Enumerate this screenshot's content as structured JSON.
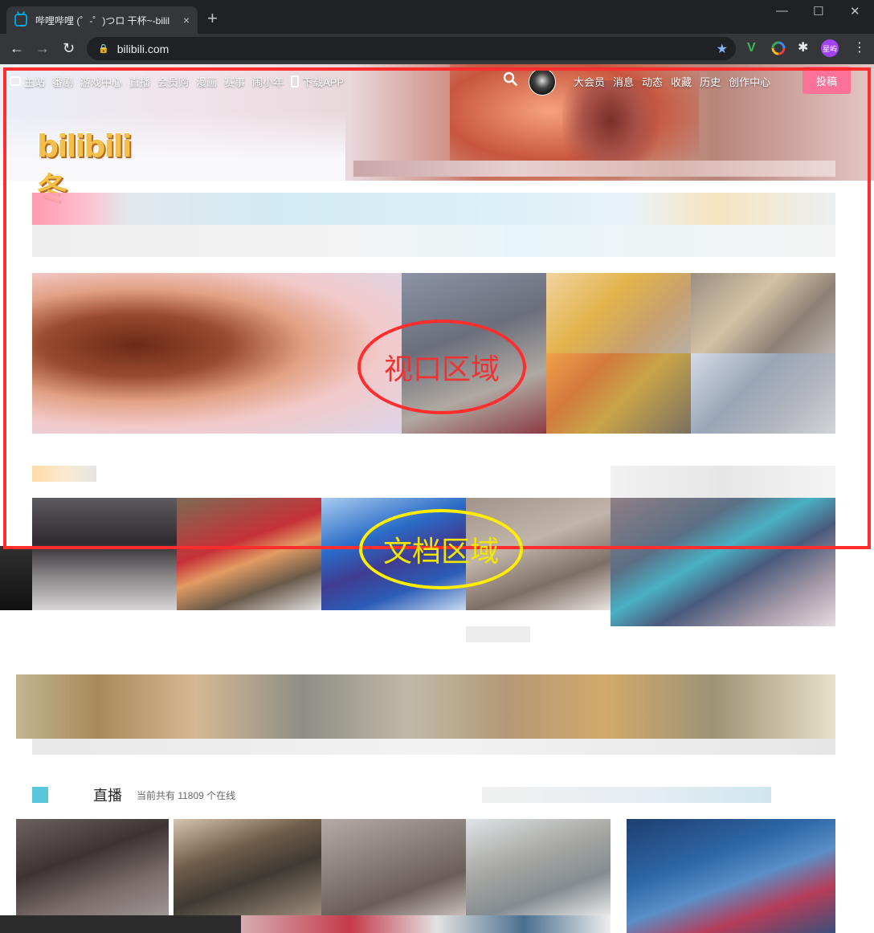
{
  "browser": {
    "tab_title": "哔哩哔哩 (゜-゜)つロ 干杯~-bilil",
    "tab_close": "×",
    "new_tab": "+",
    "minimize": "—",
    "maximize": "☐",
    "close": "✕",
    "back": "←",
    "forward": "→",
    "reload": "↻",
    "url": "bilibili.com",
    "profile_label": "星屿"
  },
  "site": {
    "logo_text": "bilibili冬",
    "nav_left": [
      "主站",
      "番剧",
      "游戏中心",
      "直播",
      "会员购",
      "漫画",
      "赛事",
      "闹小年",
      "下载APP"
    ],
    "nav_right": [
      "大会员",
      "消息",
      "动态",
      "收藏",
      "历史",
      "创作中心"
    ],
    "upload_label": "投稿"
  },
  "live_section": {
    "title": "直播",
    "count_text": "当前共有 11809 个在线"
  },
  "annotations": {
    "viewport_label": "视口区域",
    "document_label": "文档区域",
    "viewport_color": "#ff2d2d",
    "document_color": "#ffee00"
  },
  "colors": {
    "accent_pink": "#fb7299",
    "bilibili_blue": "#00a1d6"
  }
}
